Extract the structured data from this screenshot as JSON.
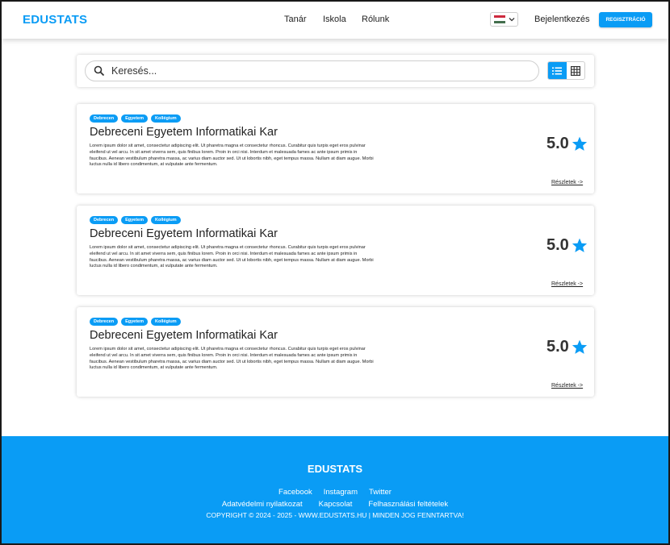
{
  "header": {
    "logo": "EDUSTATS",
    "nav": [
      "Tanár",
      "Iskola",
      "Rólunk"
    ],
    "language_flag": "hungary-flag",
    "login": "Bejelentkezés",
    "register": "REGISZTRÁCIÓ"
  },
  "search": {
    "placeholder": "Keresés...",
    "view_modes": [
      "list-view-icon",
      "grid-view-icon"
    ],
    "active_view": "list"
  },
  "cards": [
    {
      "tags": [
        "Debrecen",
        "Egyetem",
        "Kollégium"
      ],
      "title": "Debreceni Egyetem Informatikai Kar",
      "description": "Lorem ipsum dolor sit amet, consectetur adipiscing elit. Ut pharetra magna et consectetur rhoncus. Curabitur quis turpis eget eros pulvinar eleifend ut vel arcu. In sit amet viverra sem, quis finibus lorem. Proin in orci nisi. Interdum et malesuada fames ac ante ipsum primis in faucibus. Aenean vestibulum pharetra massa, ac varius diam auctor sed. Ut ut lobortis nibh, eget tempus massa. Nullam at diam augue. Morbi luctus nulla id libero condimentum, at vulputate ante fermentum.",
      "rating": "5.0",
      "details": "Részletek ->"
    },
    {
      "tags": [
        "Debrecen",
        "Egyetem",
        "Kollégium"
      ],
      "title": "Debreceni Egyetem Informatikai Kar",
      "description": "Lorem ipsum dolor sit amet, consectetur adipiscing elit. Ut pharetra magna et consectetur rhoncus. Curabitur quis turpis eget eros pulvinar eleifend ut vel arcu. In sit amet viverra sem, quis finibus lorem. Proin in orci nisi. Interdum et malesuada fames ac ante ipsum primis in faucibus. Aenean vestibulum pharetra massa, ac varius diam auctor sed. Ut ut lobortis nibh, eget tempus massa. Nullam at diam augue. Morbi luctus nulla id libero condimentum, at vulputate ante fermentum.",
      "rating": "5.0",
      "details": "Részletek ->"
    },
    {
      "tags": [
        "Debrecen",
        "Egyetem",
        "Kollégium"
      ],
      "title": "Debreceni Egyetem Informatikai Kar",
      "description": "Lorem ipsum dolor sit amet, consectetur adipiscing elit. Ut pharetra magna et consectetur rhoncus. Curabitur quis turpis eget eros pulvinar eleifend ut vel arcu. In sit amet viverra sem, quis finibus lorem. Proin in orci nisi. Interdum et malesuada fames ac ante ipsum primis in faucibus. Aenean vestibulum pharetra massa, ac varius diam auctor sed. Ut ut lobortis nibh, eget tempus massa. Nullam at diam augue. Morbi luctus nulla id libero condimentum, at vulputate ante fermentum.",
      "rating": "5.0",
      "details": "Részletek ->"
    }
  ],
  "footer": {
    "logo": "EDUSTATS",
    "social_links": [
      "Facebook",
      "Instagram",
      "Twitter"
    ],
    "legal_links": [
      "Adatvédelmi nyilatkozat",
      "Kapcsolat",
      "Felhasználási feltételek"
    ],
    "copyright": "COPYRIGHT © 2024 - 2025 - WWW.EDUSTATS.HU | MINDEN JOG FENNTARTVA!"
  },
  "colors": {
    "accent": "#0a9cf5",
    "text": "#222222"
  }
}
